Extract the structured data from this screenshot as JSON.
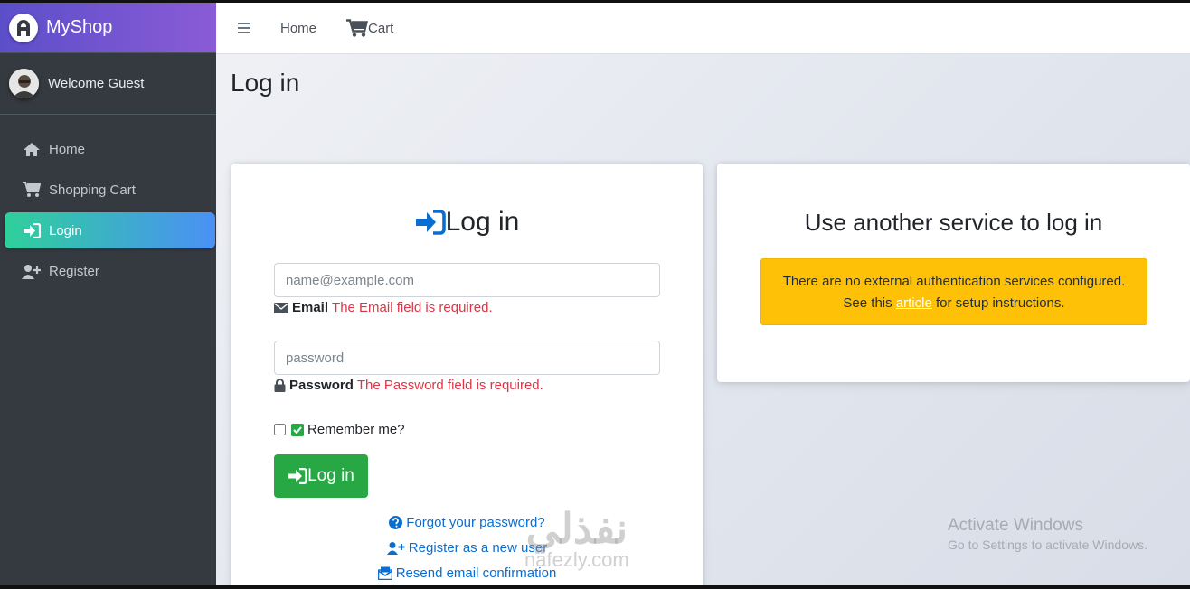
{
  "app": {
    "brand": "MyShop"
  },
  "sidebar": {
    "user": "Welcome Guest",
    "items": [
      {
        "label": "Home",
        "icon": "home-icon"
      },
      {
        "label": "Shopping Cart",
        "icon": "cart-icon"
      },
      {
        "label": "Login",
        "icon": "sign-in-icon",
        "active": true
      },
      {
        "label": "Register",
        "icon": "user-plus-icon"
      }
    ]
  },
  "topbar": {
    "home_label": "Home",
    "cart_label": "Cart"
  },
  "page": {
    "title": "Log in"
  },
  "login_card": {
    "heading": "Log in",
    "email_placeholder": "name@example.com",
    "email_label": "Email",
    "email_error": "The Email field is required.",
    "password_placeholder": "password",
    "password_label": "Password",
    "password_error": "The Password field is required.",
    "remember_label": "Remember me?",
    "button_label": "Log in",
    "forgot_label": "Forgot your password?",
    "register_label": "Register as a new user",
    "resend_label": "Resend email confirmation"
  },
  "external_card": {
    "title": "Use another service to log in",
    "alert_line1": "There are no external authentication services configured.",
    "alert_prefix": "See this",
    "alert_link": "article",
    "alert_suffix": "for setup instructions."
  },
  "overlay": {
    "windows_line1": "Activate Windows",
    "windows_line2": "Go to Settings to activate Windows.",
    "watermark_ar": "نفذلي",
    "watermark_en": "nafezly.com"
  },
  "colors": {
    "accent_green": "#28a745",
    "alert_yellow": "#ffc107",
    "link_blue": "#0a6ed1",
    "error_red": "#dc3545"
  }
}
